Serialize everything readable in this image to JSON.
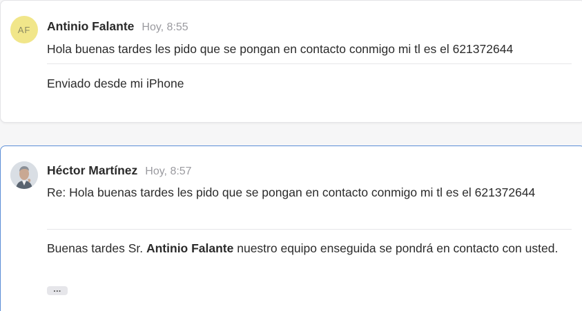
{
  "messages": [
    {
      "avatar_initials": "AF",
      "author": "Antinio Falante",
      "time": "Hoy, 8:55",
      "subject": "Hola buenas tardes les pido que se pongan en contacto conmigo mi tl es el 621372644",
      "body": "Enviado desde mi iPhone"
    },
    {
      "author": "Héctor Martínez",
      "time": "Hoy, 8:57",
      "subject": "Re: Hola buenas tardes les pido que se pongan en contacto conmigo mi tl es el 621372644",
      "body_prefix": "Buenas tardes Sr. ",
      "body_name": "Antinio Falante",
      "body_suffix": " nuestro equipo enseguida se pondrá en contacto con usted.",
      "expand_label": "..."
    }
  ],
  "colors": {
    "avatar_bg": "#f1e68a",
    "selected_border": "#5a8dd6"
  }
}
